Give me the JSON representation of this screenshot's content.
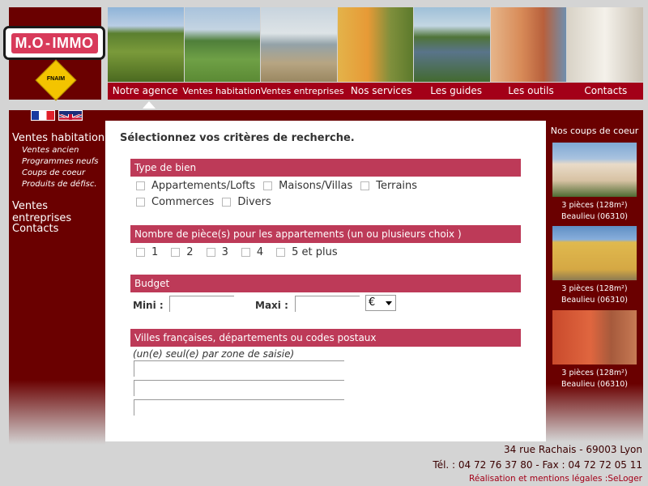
{
  "logo": {
    "brand_left": "M.O",
    "brand_right": "IMMO",
    "sub_badge": "FNAIM"
  },
  "nav": {
    "items": [
      {
        "label": "Notre agence"
      },
      {
        "label": "Ventes habitation"
      },
      {
        "label": "Ventes entreprises"
      },
      {
        "label": "Nos services"
      },
      {
        "label": "Les guides"
      },
      {
        "label": "Les outils"
      },
      {
        "label": "Contacts"
      }
    ],
    "active_index": 0
  },
  "sidebar": {
    "sections": [
      {
        "label": "Ventes habitation",
        "subs": [
          "Ventes ancien",
          "Programmes neufs",
          "Coups de coeur",
          "Produits de défisc."
        ]
      },
      {
        "label": "Ventes entreprises",
        "subs": []
      },
      {
        "label": "Contacts",
        "subs": []
      }
    ]
  },
  "main": {
    "title": "Sélectionnez vos critères de recherche.",
    "type_bien": {
      "header": "Type de bien",
      "row1": [
        "Appartements/Lofts",
        "Maisons/Villas",
        "Terrains"
      ],
      "row2": [
        "Commerces",
        "Divers"
      ]
    },
    "pieces": {
      "header": "Nombre de pièce(s) pour les appartements (un ou plusieurs choix )",
      "options": [
        "1",
        "2",
        "3",
        "4",
        "5 et plus"
      ]
    },
    "budget": {
      "header": "Budget",
      "mini_label": "Mini :",
      "maxi_label": "Maxi :",
      "currency": "€"
    },
    "villes": {
      "header": "Villes françaises, départements ou codes postaux",
      "note": "(un(e) seul(e) par zone de saisie)"
    }
  },
  "coups_de_coeur": {
    "title": "Nos coups de coeur",
    "items": [
      {
        "line1": "3 pièces (128m²)",
        "line2": "Beaulieu (06310)"
      },
      {
        "line1": "3 pièces (128m²)",
        "line2": "Beaulieu (06310)"
      },
      {
        "line1": "3 pièces (128m²)",
        "line2": "Beaulieu (06310)"
      }
    ]
  },
  "footer": {
    "address": "34 rue Rachais - 69003 Lyon",
    "phone": "Tél. : 04 72 76 37 80 - Fax : 04 72 72 05 11",
    "credits": "Réalisation et mentions légales :SeLoger"
  },
  "colors": {
    "bordeaux": "#6a0000",
    "nav_red": "#a30018",
    "section_pink": "#bd3a58",
    "page_gray": "#d4d4d4"
  }
}
